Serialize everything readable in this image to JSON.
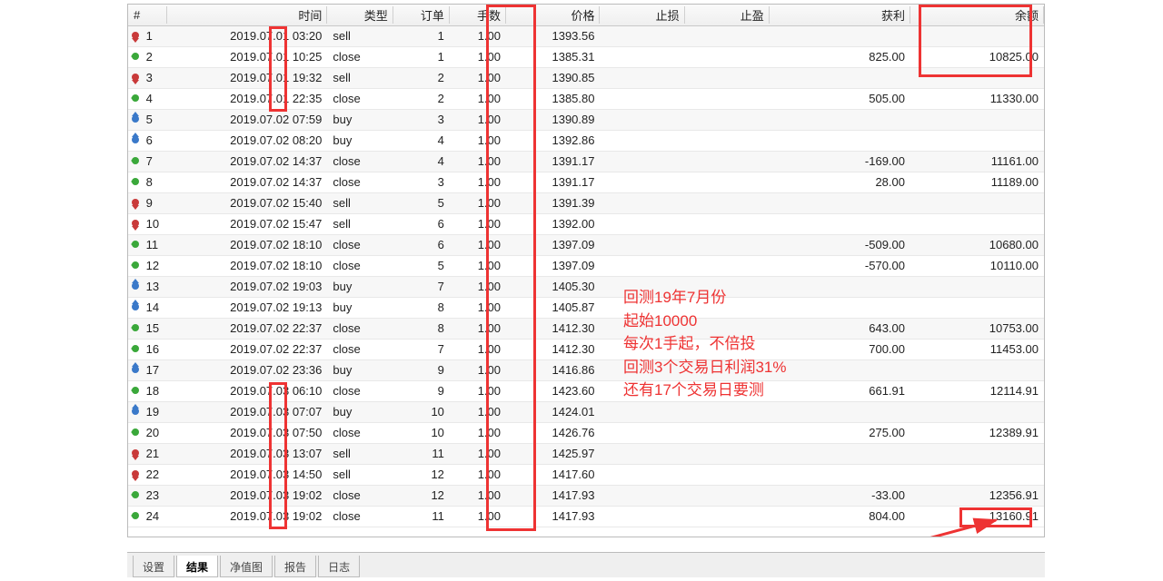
{
  "columns": {
    "idx": "#",
    "time": "时间",
    "type": "类型",
    "order": "订单",
    "lots": "手数",
    "price": "价格",
    "sl": "止损",
    "tp": "止盈",
    "profit": "获利",
    "balance": "余额"
  },
  "rows": [
    {
      "idx": 1,
      "time": "2019.07.01 03:20",
      "type": "sell",
      "order": 1,
      "lots": "1.00",
      "price": "1393.56",
      "sl": "",
      "tp": "",
      "profit": "",
      "balance": ""
    },
    {
      "idx": 2,
      "time": "2019.07.01 10:25",
      "type": "close",
      "order": 1,
      "lots": "1.00",
      "price": "1385.31",
      "sl": "",
      "tp": "",
      "profit": "825.00",
      "balance": "10825.00"
    },
    {
      "idx": 3,
      "time": "2019.07.01 19:32",
      "type": "sell",
      "order": 2,
      "lots": "1.00",
      "price": "1390.85",
      "sl": "",
      "tp": "",
      "profit": "",
      "balance": ""
    },
    {
      "idx": 4,
      "time": "2019.07.01 22:35",
      "type": "close",
      "order": 2,
      "lots": "1.00",
      "price": "1385.80",
      "sl": "",
      "tp": "",
      "profit": "505.00",
      "balance": "11330.00"
    },
    {
      "idx": 5,
      "time": "2019.07.02 07:59",
      "type": "buy",
      "order": 3,
      "lots": "1.00",
      "price": "1390.89",
      "sl": "",
      "tp": "",
      "profit": "",
      "balance": ""
    },
    {
      "idx": 6,
      "time": "2019.07.02 08:20",
      "type": "buy",
      "order": 4,
      "lots": "1.00",
      "price": "1392.86",
      "sl": "",
      "tp": "",
      "profit": "",
      "balance": ""
    },
    {
      "idx": 7,
      "time": "2019.07.02 14:37",
      "type": "close",
      "order": 4,
      "lots": "1.00",
      "price": "1391.17",
      "sl": "",
      "tp": "",
      "profit": "-169.00",
      "balance": "11161.00"
    },
    {
      "idx": 8,
      "time": "2019.07.02 14:37",
      "type": "close",
      "order": 3,
      "lots": "1.00",
      "price": "1391.17",
      "sl": "",
      "tp": "",
      "profit": "28.00",
      "balance": "11189.00"
    },
    {
      "idx": 9,
      "time": "2019.07.02 15:40",
      "type": "sell",
      "order": 5,
      "lots": "1.00",
      "price": "1391.39",
      "sl": "",
      "tp": "",
      "profit": "",
      "balance": ""
    },
    {
      "idx": 10,
      "time": "2019.07.02 15:47",
      "type": "sell",
      "order": 6,
      "lots": "1.00",
      "price": "1392.00",
      "sl": "",
      "tp": "",
      "profit": "",
      "balance": ""
    },
    {
      "idx": 11,
      "time": "2019.07.02 18:10",
      "type": "close",
      "order": 6,
      "lots": "1.00",
      "price": "1397.09",
      "sl": "",
      "tp": "",
      "profit": "-509.00",
      "balance": "10680.00"
    },
    {
      "idx": 12,
      "time": "2019.07.02 18:10",
      "type": "close",
      "order": 5,
      "lots": "1.00",
      "price": "1397.09",
      "sl": "",
      "tp": "",
      "profit": "-570.00",
      "balance": "10110.00"
    },
    {
      "idx": 13,
      "time": "2019.07.02 19:03",
      "type": "buy",
      "order": 7,
      "lots": "1.00",
      "price": "1405.30",
      "sl": "",
      "tp": "",
      "profit": "",
      "balance": ""
    },
    {
      "idx": 14,
      "time": "2019.07.02 19:13",
      "type": "buy",
      "order": 8,
      "lots": "1.00",
      "price": "1405.87",
      "sl": "",
      "tp": "",
      "profit": "",
      "balance": ""
    },
    {
      "idx": 15,
      "time": "2019.07.02 22:37",
      "type": "close",
      "order": 8,
      "lots": "1.00",
      "price": "1412.30",
      "sl": "",
      "tp": "",
      "profit": "643.00",
      "balance": "10753.00"
    },
    {
      "idx": 16,
      "time": "2019.07.02 22:37",
      "type": "close",
      "order": 7,
      "lots": "1.00",
      "price": "1412.30",
      "sl": "",
      "tp": "",
      "profit": "700.00",
      "balance": "11453.00"
    },
    {
      "idx": 17,
      "time": "2019.07.02 23:36",
      "type": "buy",
      "order": 9,
      "lots": "1.00",
      "price": "1416.86",
      "sl": "",
      "tp": "",
      "profit": "",
      "balance": ""
    },
    {
      "idx": 18,
      "time": "2019.07.03 06:10",
      "type": "close",
      "order": 9,
      "lots": "1.00",
      "price": "1423.60",
      "sl": "",
      "tp": "",
      "profit": "661.91",
      "balance": "12114.91"
    },
    {
      "idx": 19,
      "time": "2019.07.03 07:07",
      "type": "buy",
      "order": 10,
      "lots": "1.00",
      "price": "1424.01",
      "sl": "",
      "tp": "",
      "profit": "",
      "balance": ""
    },
    {
      "idx": 20,
      "time": "2019.07.03 07:50",
      "type": "close",
      "order": 10,
      "lots": "1.00",
      "price": "1426.76",
      "sl": "",
      "tp": "",
      "profit": "275.00",
      "balance": "12389.91"
    },
    {
      "idx": 21,
      "time": "2019.07.03 13:07",
      "type": "sell",
      "order": 11,
      "lots": "1.00",
      "price": "1425.97",
      "sl": "",
      "tp": "",
      "profit": "",
      "balance": ""
    },
    {
      "idx": 22,
      "time": "2019.07.03 14:50",
      "type": "sell",
      "order": 12,
      "lots": "1.00",
      "price": "1417.60",
      "sl": "",
      "tp": "",
      "profit": "",
      "balance": ""
    },
    {
      "idx": 23,
      "time": "2019.07.03 19:02",
      "type": "close",
      "order": 12,
      "lots": "1.00",
      "price": "1417.93",
      "sl": "",
      "tp": "",
      "profit": "-33.00",
      "balance": "12356.91"
    },
    {
      "idx": 24,
      "time": "2019.07.03 19:02",
      "type": "close",
      "order": 11,
      "lots": "1.00",
      "price": "1417.93",
      "sl": "",
      "tp": "",
      "profit": "804.00",
      "balance": "13160.91"
    }
  ],
  "annotation": {
    "l1": "回测19年7月份",
    "l2": "起始10000",
    "l3": "每次1手起，不倍投",
    "l4": "回测3个交易日利润31%",
    "l5": "还有17个交易日要测"
  },
  "tabs": {
    "t1": "设置",
    "t2": "结果",
    "t3": "净值图",
    "t4": "报告",
    "t5": "日志"
  }
}
